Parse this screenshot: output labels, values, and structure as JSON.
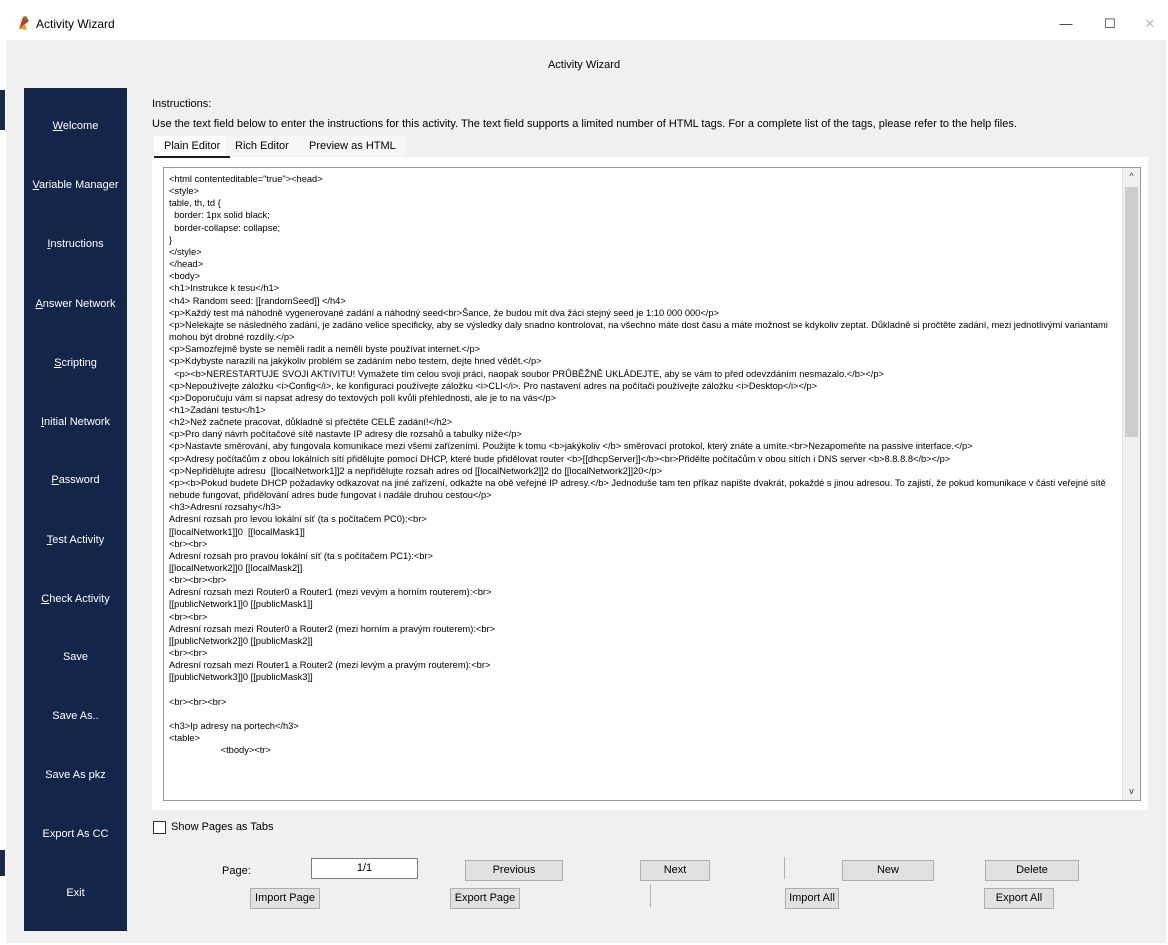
{
  "window": {
    "title": "Activity Wizard",
    "minimize_glyph": "—",
    "maximize_glyph": "☐",
    "close_glyph": "✕"
  },
  "header": {
    "title": "Activity Wizard"
  },
  "sidebar": {
    "items": [
      {
        "label": "Welcome",
        "mnemonic": "W"
      },
      {
        "label": "Variable Manager",
        "mnemonic": "V"
      },
      {
        "label": "Instructions",
        "mnemonic": "I"
      },
      {
        "label": "Answer Network",
        "mnemonic": "A"
      },
      {
        "label": "Scripting",
        "mnemonic": "S"
      },
      {
        "label": "Initial Network",
        "mnemonic": "I"
      },
      {
        "label": "Password",
        "mnemonic": "P"
      },
      {
        "label": "Test Activity",
        "mnemonic": "T"
      },
      {
        "label": "Check Activity",
        "mnemonic": "C"
      },
      {
        "label": "Save",
        "mnemonic": ""
      },
      {
        "label": "Save As..",
        "mnemonic": ""
      },
      {
        "label": "Save As pkz",
        "mnemonic": ""
      },
      {
        "label": "Export As CC",
        "mnemonic": ""
      },
      {
        "label": "Exit",
        "mnemonic": ""
      }
    ],
    "colors": {
      "background": "#14254a",
      "text": "#ffffff"
    }
  },
  "instructions": {
    "label": "Instructions:",
    "description": "Use the text field below to enter the instructions for this activity. The text field supports a limited number of HTML tags. For a complete list of the tags, please refer to the help files."
  },
  "tabs": [
    {
      "label": "Plain Editor",
      "selected": true
    },
    {
      "label": "Rich Editor",
      "selected": false
    },
    {
      "label": "Preview as HTML",
      "selected": false
    }
  ],
  "editor": {
    "lines": [
      "<html contenteditable=\"true\"><head>",
      "<style>",
      "table, th, td {",
      "  border: 1px solid black;",
      "  border-collapse: collapse;",
      "}",
      "</style>",
      "</head>",
      "<body>",
      "<h1>Instrukce k tesu</h1>",
      "<h4> Random seed: [[randomSeed]] </h4>",
      "<p>Každý test má náhodně vygenerované zadání a náhodný seed<br>Šance, že budou mít dva žáci stejný seed je 1:10 000 000</p>",
      "<p>Nelekajte se následného zadání, je zadáno velice specificky, aby se výsledky daly snadno kontrolovat, na všechno máte dost času a máte možnost se kdykoliv zeptat. Důkladně si pročtěte zadání, mezi jednotlivými variantami mohou být drobné rozdíly.</p>",
      "<p>Samozřejmě byste se neměli radit a neměli byste používat internet.</p>",
      "<p>Kdybyste narazili na jakýkoliv problém se zadáním nebo testem, dejte hned vědět.</p>",
      "  <p><b>NERESTARTUJE SVOJI AKTIVITU! Vymažete tím celou svoji práci, naopak soubor PRŮBĚŽNĚ UKLÁDEJTE, aby se vám to před odevzdáním nesmazalo.</b></p>",
      "<p>Nepoužívejte záložku <i>Config</i>, ke konfiguraci používejte záložku <i>CLI</i>. Pro nastavení adres na počítači používejte záložku <i>Desktop</i></p>",
      "<p>Doporučuju vám si napsat adresy do textových polí kvůli přehlednosti, ale je to na vás</p>",
      "<h1>Zadání testu</h1>",
      "<h2>Než začnete pracovat, důkladně si přečtěte CELÉ zadání!</h2>",
      "<p>Pro daný návrh počítačové sítě nastavte IP adresy dle rozsahů a tabulky níže</p>",
      "<p>Nastavte směrování, aby fungovala komunikace mezi všemi zařízeními. Použijte k tomu <b>jakýkoliv </b> směrovací protokol, který znáte a umíte.<br>Nezapomeňte na passive interface.</p>",
      "<p>Adresy počítačům z obou lokálních sítí přidělujte pomocí DHCP, které bude přidělovat router <b>[[dhcpServer]]</b><br>Přidělte počítačům v obou sítích i DNS server <b>8.8.8.8</b></p>",
      "<p>Nepřidělujte adresu  [[localNetwork1]]2 a nepřidělujte rozsah adres od [[localNetwork2]]2 do [[localNetwork2]]20</p>",
      "<p><b>Pokud budete DHCP požadavky odkazovat na jiné zařízení, odkažte na obě veřejné IP adresy.</b> Jednoduše tam ten příkaz napište dvakrát, pokaždé s jinou adresou. To zajistí, že pokud komunikace v části veřejné sítě nebude fungovat, přidělování adres bude fungovat i nadále druhou cestou</p>",
      "<h3>Adresní rozsahy</h3>",
      "Adresní rozsah pro levou lokální síť (ta s počítačem PC0):<br>",
      "[[localNetwork1]]0  [[localMask1]]",
      "<br><br>",
      "Adresní rozsah pro pravou lokální síť (ta s počítačem PC1):<br>",
      "[[localNetwork2]]0 [[localMask2]]",
      "<br><br><br>",
      "Adresní rozsah mezi Router0 a Router1 (mezi vevým a horním routerem):<br>",
      "[[publicNetwork1]]0 [[publicMask1]]",
      "<br><br>",
      "Adresní rozsah mezi Router0 a Router2 (mezi horním a pravým routerem):<br>",
      "[[publicNetwork2]]0 [[publicMask2]]",
      "<br><br>",
      "Adresní rozsah mezi Router1 a Router2 (mezi levým a pravým routerem):<br>",
      "[[publicNetwork3]]0 [[publicMask3]]",
      "",
      "<br><br><br>",
      "",
      "<h3>Ip adresy na portech</h3>",
      "<table>",
      "                    <tbody><tr>"
    ],
    "scroll_up_glyph": "^",
    "scroll_down_glyph": "v"
  },
  "options": {
    "show_pages_as_tabs_label": "Show Pages as Tabs",
    "show_pages_as_tabs_checked": false
  },
  "pagination": {
    "page_label": "Page:",
    "page_value": "1/1",
    "previous_label": "Previous",
    "next_label": "Next",
    "new_label": "New",
    "delete_label": "Delete",
    "import_page_label": "Import Page",
    "export_page_label": "Export Page",
    "import_all_label": "Import All",
    "export_all_label": "Export All"
  }
}
